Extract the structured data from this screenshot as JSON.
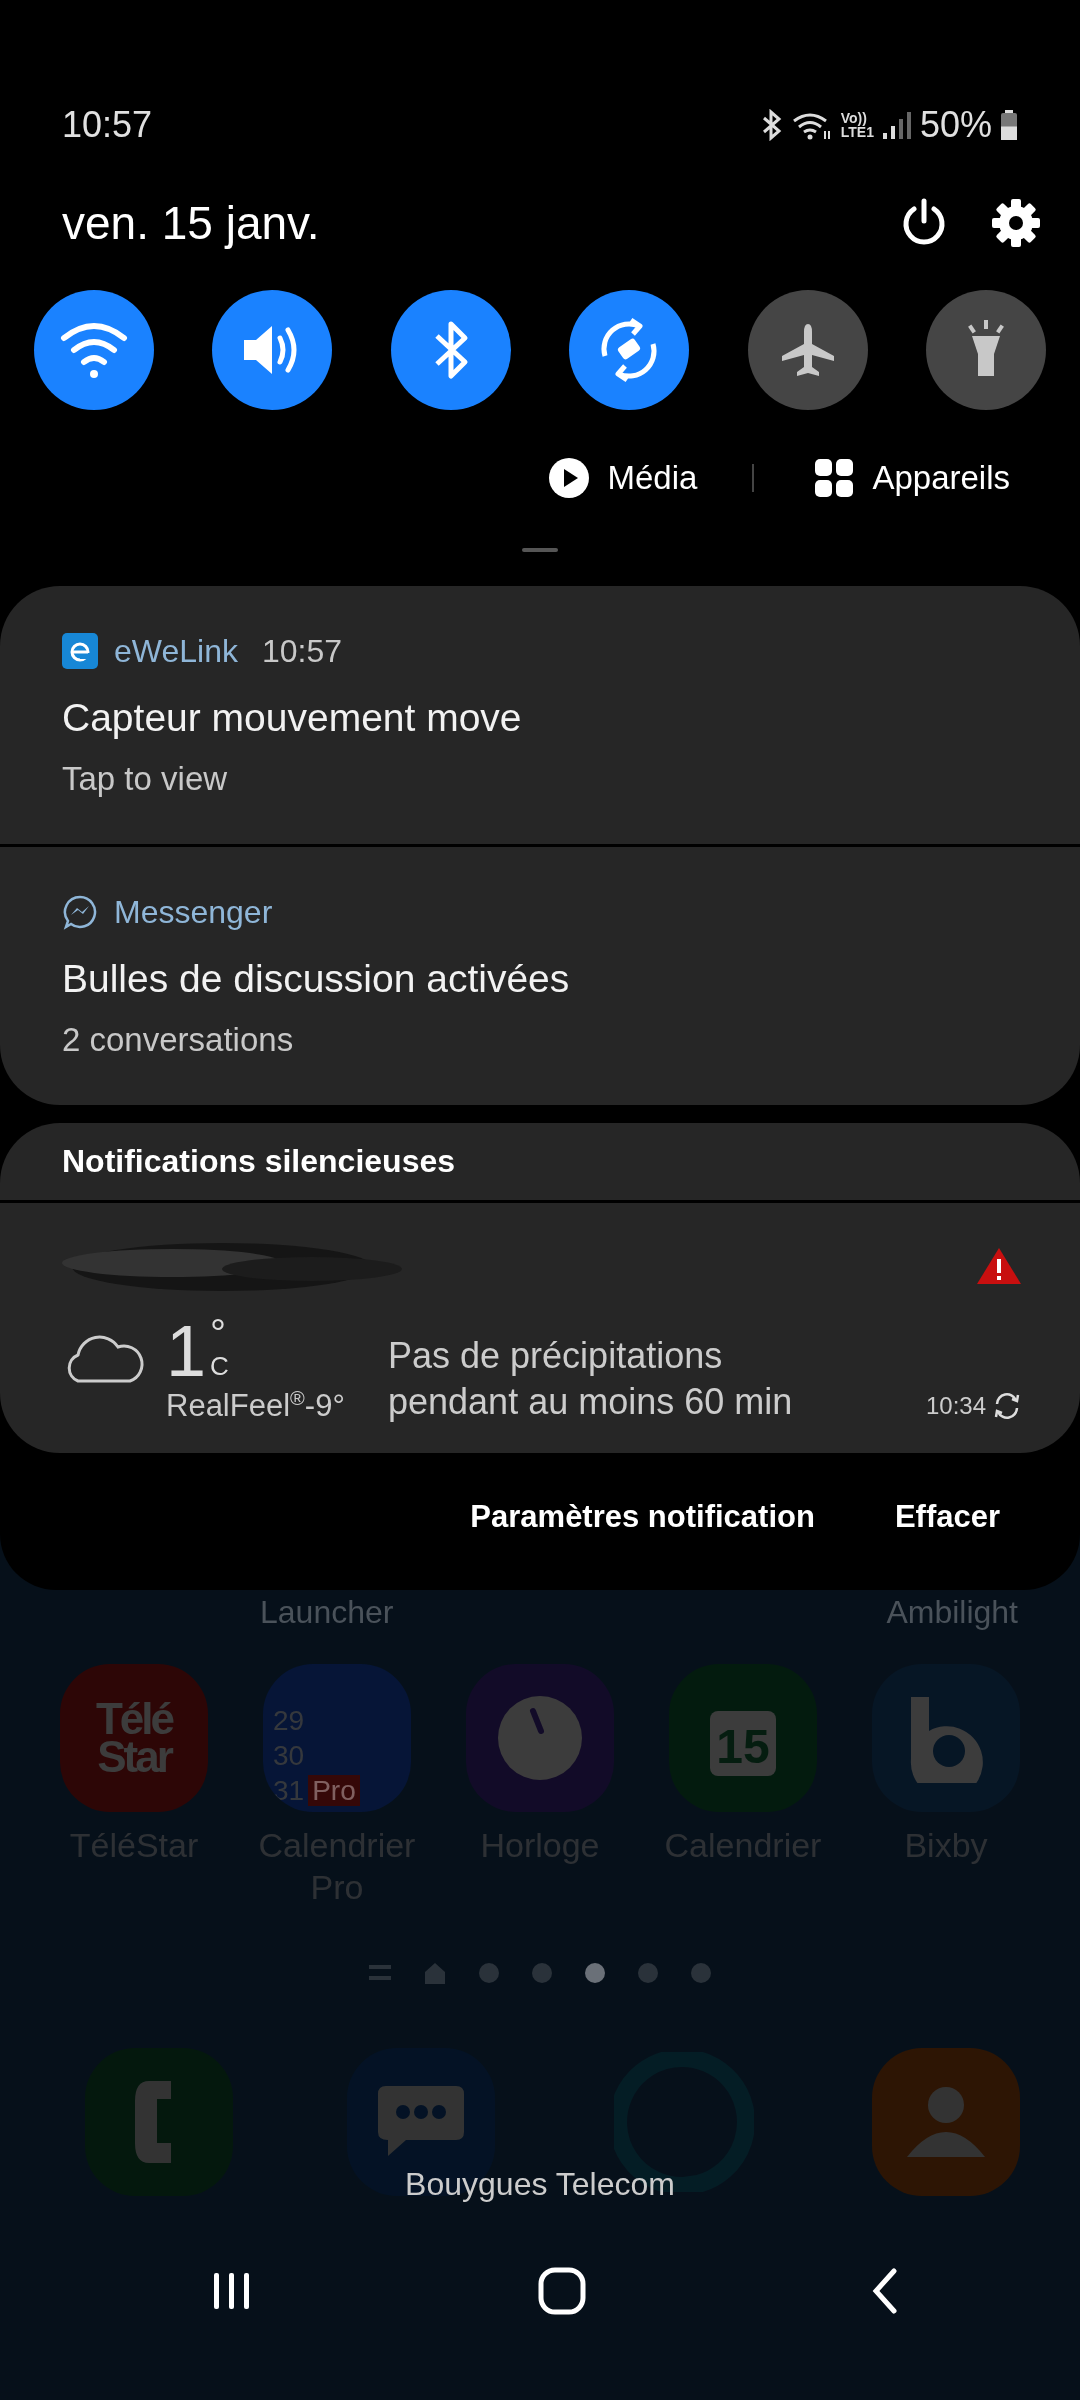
{
  "status_bar": {
    "time": "10:57",
    "network": "Vo))",
    "network_sub": "LTE1",
    "battery": "50%"
  },
  "header": {
    "date": "ven. 15 janv."
  },
  "toggles": [
    {
      "kind": "wifi",
      "on": true
    },
    {
      "kind": "sound",
      "on": true
    },
    {
      "kind": "bluetooth",
      "on": true
    },
    {
      "kind": "rotate",
      "on": true
    },
    {
      "kind": "airplane",
      "on": false
    },
    {
      "kind": "flashlight",
      "on": false
    }
  ],
  "panel_links": [
    {
      "kind": "media",
      "label": "Média"
    },
    {
      "kind": "devices",
      "label": "Appareils"
    }
  ],
  "notifications": [
    {
      "kind": "ewelink",
      "app": "eWeLink",
      "time": "10:57",
      "title": "Capteur mouvement move",
      "text": "Tap to view"
    },
    {
      "kind": "messenger",
      "app": "Messenger",
      "title": "Bulles de discussion activées",
      "text": "2 conversations"
    }
  ],
  "silent": {
    "title": "Notifications silencieuses",
    "weather": {
      "temp": "1",
      "deg": "°",
      "unit": "C",
      "realfeel": "RealFeel$^{®}$-9°",
      "forecast": "Pas de précipitations pendant au moins 60 min",
      "updated": "10:34"
    }
  },
  "actions": [
    "Paramètres notification",
    "Effacer"
  ],
  "home": {
    "top_labels": [
      "Launcher",
      "Ambilight"
    ],
    "apps": [
      {
        "kind": "telestar",
        "label": "TéléStar",
        "icon_text": [
          "Télé",
          "Star"
        ]
      },
      {
        "kind": "calpro",
        "label": "Calendrier Pro",
        "icon_text": [
          "29",
          "30",
          "31",
          "Pro"
        ]
      },
      {
        "kind": "clock",
        "label": "Horloge"
      },
      {
        "kind": "calendar",
        "label": "Calendrier",
        "icon_text": [
          "15"
        ]
      },
      {
        "kind": "bixby",
        "label": "Bixby"
      }
    ],
    "pages": [
      {
        "kind": "menu",
        "selected": false
      },
      {
        "kind": "home",
        "selected": false
      },
      {
        "kind": "dot",
        "selected": false
      },
      {
        "kind": "dot",
        "selected": false
      },
      {
        "kind": "dot",
        "selected": true
      },
      {
        "kind": "dot",
        "selected": false
      },
      {
        "kind": "dot",
        "selected": false
      }
    ],
    "dock": [
      {
        "kind": "phone"
      },
      {
        "kind": "messages"
      },
      {
        "kind": "alexa"
      },
      {
        "kind": "contacts"
      }
    ],
    "carrier": "Bouygues Telecom"
  }
}
